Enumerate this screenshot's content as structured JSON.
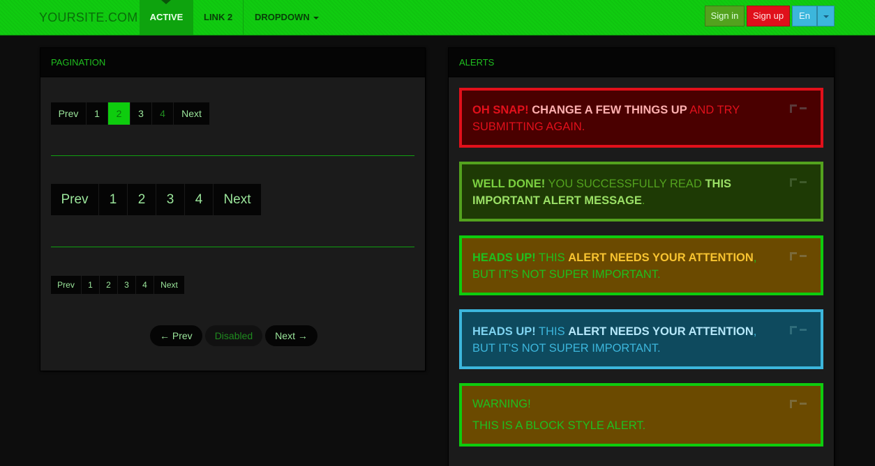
{
  "navbar": {
    "brand": "YOURSITE.COM",
    "items": [
      {
        "label": "Active"
      },
      {
        "label": "Link 2"
      },
      {
        "label": "Dropdown"
      }
    ],
    "signin": "Sign in",
    "signup": "Sign up",
    "lang": "En"
  },
  "pagination": {
    "title": "Pagination",
    "default": [
      "Prev",
      "1",
      "2",
      "3",
      "4",
      "Next"
    ],
    "large": [
      "Prev",
      "1",
      "2",
      "3",
      "4",
      "Next"
    ],
    "small": [
      "Prev",
      "1",
      "2",
      "3",
      "4",
      "Next"
    ],
    "pager": {
      "prev": "← Prev",
      "disabled": "Disabled",
      "next": "Next →"
    }
  },
  "alerts": {
    "title": "Alerts",
    "danger": {
      "strong": "Oh snap!",
      "hl": "Change a few things up",
      "rest": " and try submitting again."
    },
    "success": {
      "strong": "Well done!",
      "mid": " You successfully read ",
      "hl": "this important alert message",
      "end": "."
    },
    "warning": {
      "strong": "Heads up!",
      "mid": " This ",
      "hl": "alert needs your attention",
      "end": ", but it's not super important."
    },
    "info": {
      "strong": "Heads up!",
      "mid": " This ",
      "hl": "alert needs your attention",
      "end": ", but it's not super important."
    },
    "block": {
      "heading": "Warning!",
      "body": "This is a block style alert."
    }
  },
  "colors": {
    "accent": "#0ecc0e",
    "danger": "#e2101b",
    "success": "#53a21e",
    "info": "#3cb6dc",
    "warning_bg": "#6b4a00"
  }
}
